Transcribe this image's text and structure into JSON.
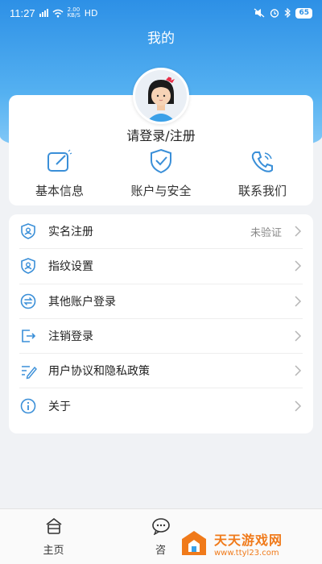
{
  "status_bar": {
    "time": "11:27",
    "network_speed": "2.00\nKB/S",
    "hd_label": "HD",
    "battery": "65"
  },
  "header": {
    "title": "我的"
  },
  "profile": {
    "login_text": "请登录/注册",
    "quick_actions": [
      {
        "label": "基本信息",
        "icon": "edit-icon"
      },
      {
        "label": "账户与安全",
        "icon": "shield-icon"
      },
      {
        "label": "联系我们",
        "icon": "phone-icon"
      }
    ]
  },
  "menu": {
    "items": [
      {
        "label": "实名注册",
        "value": "未验证",
        "icon": "id-verify-icon"
      },
      {
        "label": "指纹设置",
        "value": "",
        "icon": "fingerprint-icon"
      },
      {
        "label": "其他账户登录",
        "value": "",
        "icon": "switch-account-icon"
      },
      {
        "label": "注销登录",
        "value": "",
        "icon": "logout-icon"
      },
      {
        "label": "用户协议和隐私政策",
        "value": "",
        "icon": "agreement-icon"
      },
      {
        "label": "关于",
        "value": "",
        "icon": "info-icon"
      }
    ]
  },
  "bottom_nav": {
    "items": [
      {
        "label": "主页",
        "icon": "home-icon"
      },
      {
        "label": "咨",
        "icon": "chat-icon"
      }
    ]
  },
  "watermark": {
    "title": "天天游戏网",
    "url": "www.ttyl23.com"
  },
  "colors": {
    "accent": "#2d90e6",
    "icon_blue": "#3a8fd8"
  }
}
